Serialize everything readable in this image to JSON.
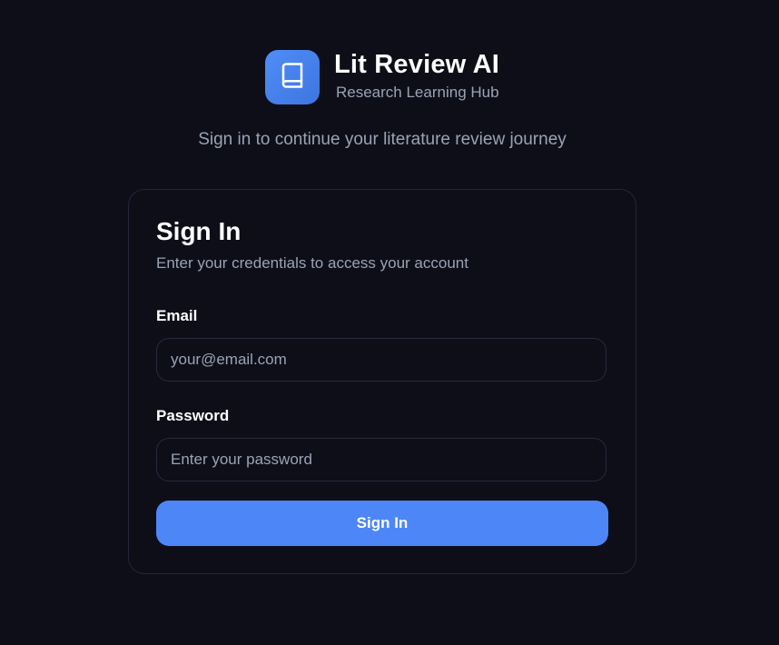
{
  "brand": {
    "title": "Lit Review AI",
    "subtitle": "Research Learning Hub",
    "logo_icon": "book-icon",
    "accent": "#4d86f7"
  },
  "tagline": "Sign in to continue your literature review journey",
  "signin": {
    "title": "Sign In",
    "subtitle": "Enter your credentials to access your account",
    "email": {
      "label": "Email",
      "placeholder": "your@email.com",
      "value": ""
    },
    "password": {
      "label": "Password",
      "placeholder": "Enter your password",
      "value": ""
    },
    "submit_label": "Sign In"
  },
  "colors": {
    "background": "#0d0e18",
    "muted_text": "#9aa3b5",
    "border": "#23263a"
  }
}
